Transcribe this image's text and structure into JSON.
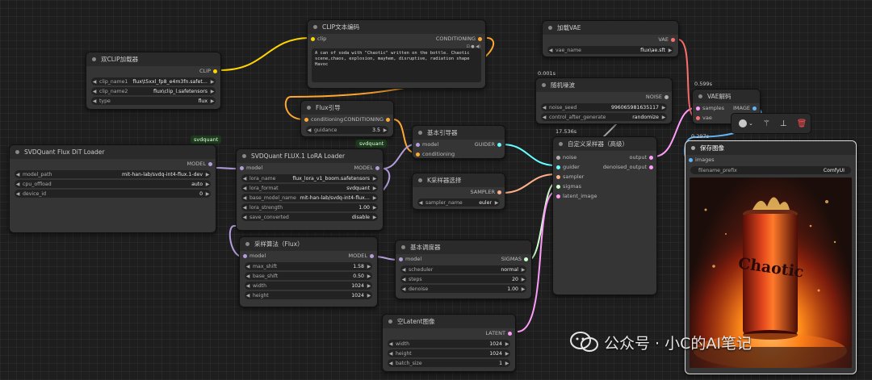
{
  "colors": {
    "canvas": "#1e1e1e",
    "node_bg": "#353535",
    "clip": "#ffd500",
    "conditioning": "#ffa931",
    "model": "#b39ddb",
    "vae": "#ff6e6e",
    "guider": "#66ffff",
    "sampler": "#ffb08a",
    "sigmas": "#cdffcd",
    "latent": "#ff9cf9",
    "image": "#64b5f6",
    "noise": "#b0b0b0",
    "float": "#aaee88"
  },
  "nodes": {
    "dual_clip": {
      "title": "双CLIP加载器",
      "out_clip": "CLIP",
      "clip_name1_label": "clip_name1",
      "clip_name1_value": "flux\\t5xxl_fp8_e4m3fn.safet…",
      "clip_name2_label": "clip_name2",
      "clip_name2_value": "flux\\clip_l.safetensors",
      "type_label": "type",
      "type_value": "flux"
    },
    "clip_encode": {
      "title": "CLIP文本编码",
      "in_clip": "clip",
      "out_conditioning": "CONDITIONING",
      "text": "A can of soda with \"Chaotic\" written on the bottle. Chaotic scene,chaos, explosion, mayhem, disruptive, radiation shape Havoc"
    },
    "flux_guidance": {
      "title": "Flux引导",
      "in_conditioning": "conditioning",
      "out_conditioning": "CONDITIONING",
      "guidance_label": "guidance",
      "guidance_value": "3.5"
    },
    "svd_loader": {
      "title": "SVDQuant Flux DiT Loader",
      "badge": "svdquant",
      "out_model": "MODEL",
      "model_path_label": "model_path",
      "model_path_value": "mit-han-lab/svdq-int4-flux.1-dev",
      "cpu_offload_label": "cpu_offload",
      "cpu_offload_value": "auto",
      "device_id_label": "device_id",
      "device_id_value": "0"
    },
    "lora_loader": {
      "title": "SVDQuant FLUX.1 LoRA Loader",
      "badge": "svdquant",
      "in_model": "model",
      "out_model": "MODEL",
      "lora_name_label": "lora_name",
      "lora_name_value": "flux_lora_v1_boom.safetensors",
      "lora_format_label": "lora_format",
      "lora_format_value": "svdquant",
      "base_model_label": "base_model_name",
      "base_model_value": "mit-han-lab/svdq-int4-flux…",
      "lora_strength_label": "lora_strength",
      "lora_strength_value": "1.00",
      "save_converted_label": "save_converted",
      "save_converted_value": "disable"
    },
    "basic_guider": {
      "title": "基本引导器",
      "in_model": "model",
      "in_conditioning": "conditioning",
      "out_guider": "GUIDER"
    },
    "ksampler_select": {
      "title": "K采样器选择",
      "out_sampler": "SAMPLER",
      "sampler_name_label": "sampler_name",
      "sampler_name_value": "euler"
    },
    "model_sampling": {
      "title": "采样算法（Flux）",
      "in_model": "model",
      "out_model": "MODEL",
      "max_shift_label": "max_shift",
      "max_shift_value": "1.58",
      "base_shift_label": "base_shift",
      "base_shift_value": "0.50",
      "width_label": "width",
      "width_value": "1024",
      "height_label": "height",
      "height_value": "1024"
    },
    "basic_scheduler": {
      "title": "基本调度器",
      "in_model": "model",
      "out_sigmas": "SIGMAS",
      "scheduler_label": "scheduler",
      "scheduler_value": "normal",
      "steps_label": "steps",
      "steps_value": "20",
      "denoise_label": "denoise",
      "denoise_value": "1.00"
    },
    "empty_latent": {
      "title": "空Latent图像",
      "out_latent": "LATENT",
      "width_label": "width",
      "width_value": "1024",
      "height_label": "height",
      "height_value": "1024",
      "batch_label": "batch_size",
      "batch_value": "1"
    },
    "vae_loader": {
      "title": "加载VAE",
      "out_vae": "VAE",
      "vae_name_label": "vae_name",
      "vae_name_value": "flux\\ae.sft"
    },
    "random_noise": {
      "title": "随机噪波",
      "timing": "0.001s",
      "out_noise": "NOISE",
      "noise_seed_label": "noise_seed",
      "noise_seed_value": "996065981635117",
      "control_label": "control_after_generate",
      "control_value": "randomize"
    },
    "custom_sampler": {
      "title": "自定义采样器（高级）",
      "timing": "17.536s",
      "in_noise": "noise",
      "in_guider": "guider",
      "in_sampler": "sampler",
      "in_sigmas": "sigmas",
      "in_latent": "latent_image",
      "out_output": "output",
      "out_denoised": "denoised_output"
    },
    "vae_decode": {
      "title": "VAE解码",
      "timing": "0.599s",
      "in_samples": "samples",
      "in_vae": "vae",
      "out_image": "IMAGE"
    },
    "save_image": {
      "title": "保存图像",
      "timing": "0.297s",
      "in_images": "images",
      "prefix_label": "filename_prefix",
      "prefix_value": "ComfyUI",
      "can_text": "Chaotic"
    }
  },
  "toolbar": {
    "color_icon": "color-circle-icon",
    "bypass_icon": "wand-icon",
    "pin_icon": "pin-icon",
    "delete_icon": "trash-icon"
  },
  "watermark": {
    "text": "公众号 · 小C的AI笔记",
    "icon": "wechat-icon"
  }
}
